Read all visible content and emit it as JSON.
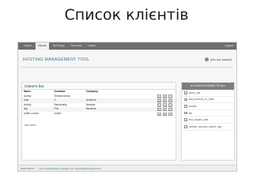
{
  "slide": {
    "title": "Список клієнтів"
  },
  "nav": {
    "tabs": [
      "Home",
      "Clients",
      "Sell Keys",
      "Services",
      "Users"
    ],
    "active_index": 1,
    "logout": "Logout"
  },
  "app": {
    "title": "HOSTING MANAGEMENT TOOL",
    "user": "john.doe (admin)"
  },
  "clients": {
    "panel_title": "Client's list",
    "columns": [
      "Name",
      "Surname",
      "Company"
    ],
    "rows": [
      [
        "Andriy",
        "Tereshchenko",
        ""
      ],
      [
        "Ivan",
        "V.",
        "Uniserve"
      ],
      [
        "Andriy",
        "Bardovskiy",
        "Nardela"
      ],
      [
        "Ilya",
        "Pnn",
        "Nardena"
      ],
      [
        "public cvizan",
        "vorkia",
        ""
      ]
    ],
    "actions": [
      "edit",
      "delete",
      "open"
    ],
    "add_link": "Add client"
  },
  "accounts": {
    "title": "ACCOUNTS ADDED TO ALL",
    "items": [
      "demo_site",
      "test_account_no_client",
      "boxinfo",
      "lab",
      "test_zoophil_sale",
      "number_account_sorted_mgr"
    ]
  },
  "footer": {
    "left": "build 2014.07",
    "right": "+ john.doe@hosting-manager.com  support@hostingtool.net"
  }
}
